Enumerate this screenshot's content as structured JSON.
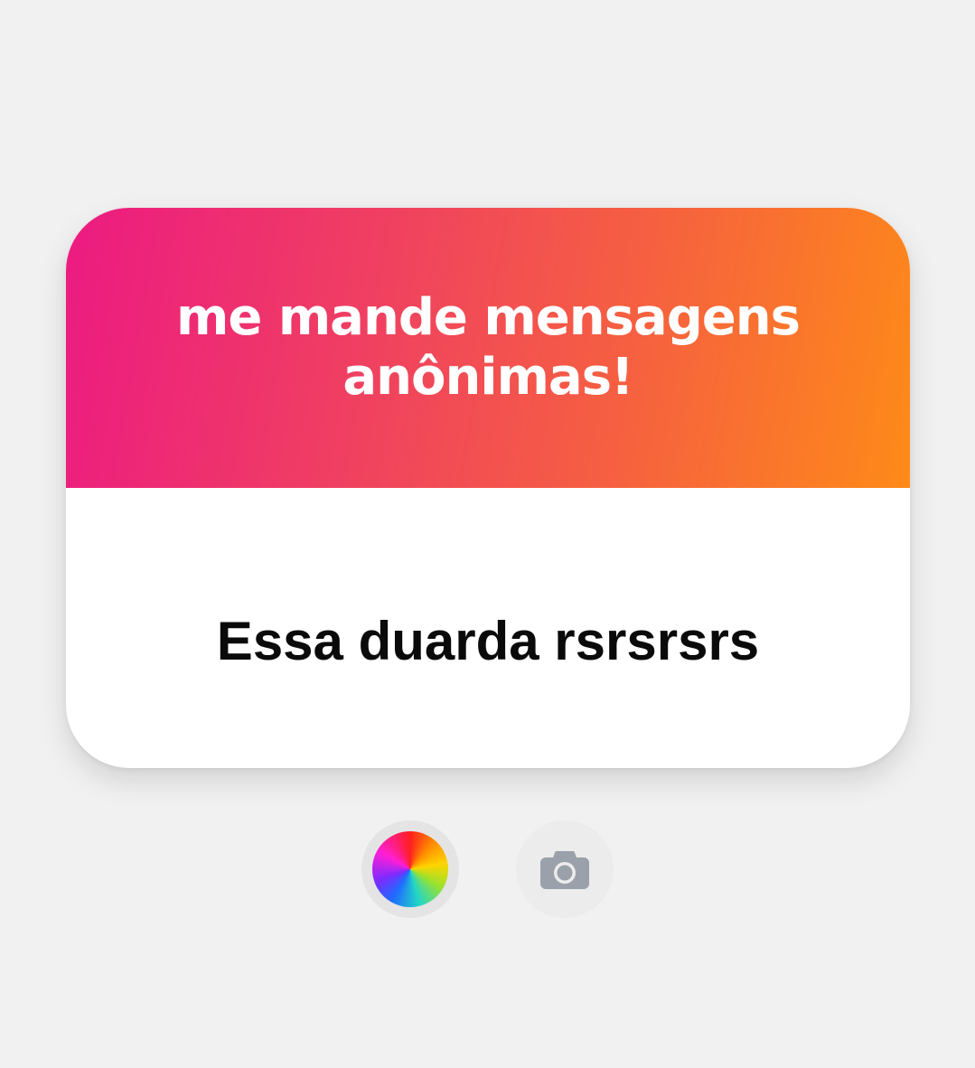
{
  "sticker": {
    "prompt": "me mande mensagens anônimas!",
    "answer": "Essa duarda rsrsrsrs",
    "gradient_colors": [
      "#ec1a82",
      "#f0425f",
      "#f6623e",
      "#fe8a18"
    ]
  },
  "controls": {
    "color_button_icon": "color-wheel-icon",
    "camera_button_icon": "camera-icon"
  }
}
